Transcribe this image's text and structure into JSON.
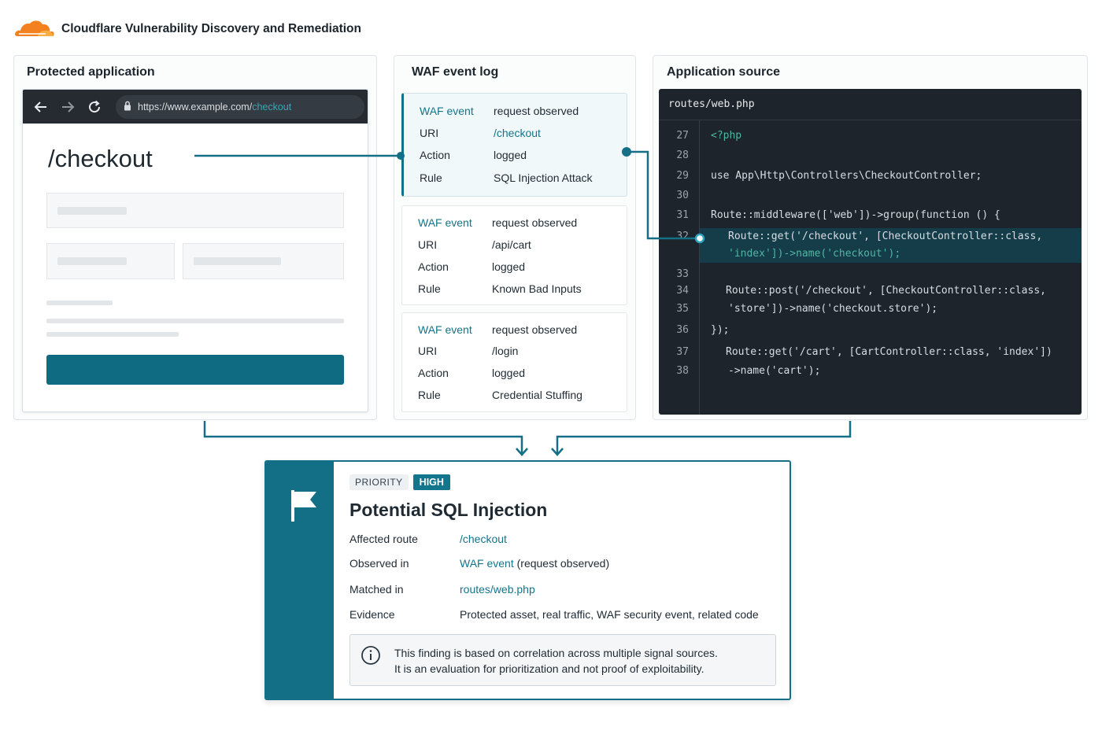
{
  "header": {
    "title": "Cloudflare Vulnerability Discovery and Remediation",
    "logo_icon": "cloudflare-cloud-icon",
    "logo_color": "#f48120"
  },
  "panel_app": {
    "title": "Protected application",
    "browser": {
      "url_base": "https://www.example.com/",
      "url_path": "checkout",
      "page_title": "/checkout"
    }
  },
  "panel_log": {
    "title": "WAF event log",
    "events": [
      {
        "type": "WAF event",
        "type_value": "request observed",
        "uri_label": "URI",
        "uri": "/checkout",
        "action_label": "Action",
        "action": "logged",
        "rule_label": "Rule",
        "rule": "SQL Injection Attack"
      },
      {
        "type": "WAF event",
        "type_value": "request observed",
        "uri_label": "URI",
        "uri": "/api/cart",
        "action_label": "Action",
        "action": "logged",
        "rule_label": "Rule",
        "rule": "Known Bad Inputs"
      },
      {
        "type": "WAF event",
        "type_value": "request observed",
        "uri_label": "URI",
        "uri": "/login",
        "action_label": "Action",
        "action": "logged",
        "rule_label": "Rule",
        "rule": "Credential Stuffing"
      }
    ]
  },
  "panel_source": {
    "title": "Application source",
    "file": "routes/web.php",
    "lines": [
      {
        "n": "27",
        "code": "<?php"
      },
      {
        "n": "28",
        "code": ""
      },
      {
        "n": "29",
        "code": "use App\\Http\\Controllers\\CheckoutController;"
      },
      {
        "n": "30",
        "code": ""
      },
      {
        "n": "31",
        "code": "Route::middleware(['web'])->group(function () {"
      },
      {
        "n": "32",
        "code": "Route::get('/checkout', [CheckoutController::class,"
      },
      {
        "n": "",
        "code": "'index'])->name('checkout');"
      },
      {
        "n": "33",
        "code": ""
      },
      {
        "n": "34",
        "code": "Route::post('/checkout', [CheckoutController::class,"
      },
      {
        "n": "35",
        "code": "'store'])->name('checkout.store');"
      },
      {
        "n": "36",
        "code": "});"
      },
      {
        "n": "37",
        "code": "Route::get('/cart', [CartController::class, 'index'])"
      },
      {
        "n": "38",
        "code": "->name('cart');"
      }
    ]
  },
  "finding": {
    "priority_label": "PRIORITY",
    "priority_value": "HIGH",
    "title": "Potential SQL Injection",
    "rows": [
      {
        "key": "Affected route",
        "value": "/checkout"
      },
      {
        "key": "Observed in",
        "value_em": "WAF event",
        "value_rest": " (request observed)"
      },
      {
        "key": "Matched in",
        "value": "routes/web.php"
      },
      {
        "key": "Evidence",
        "value": "Protected asset, real traffic, WAF security event, related code"
      }
    ],
    "note_line1": "This finding is based on correlation across multiple signal sources.",
    "note_line2": "It is an evaluation for prioritization and not proof of exploitability."
  },
  "colors": {
    "accent": "#156f86",
    "code_bg": "#1d242b",
    "code_highlight": "#153d49"
  }
}
